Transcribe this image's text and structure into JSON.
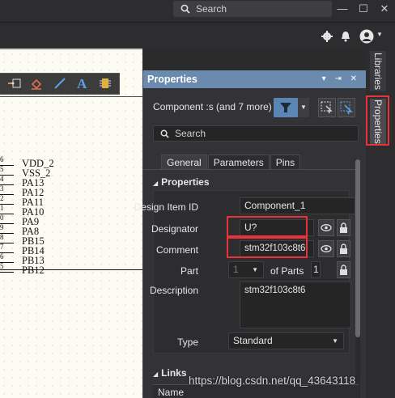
{
  "titlebar": {
    "search_placeholder": "Search",
    "minimize": "—",
    "maximize": "☐",
    "close": "✕"
  },
  "schematic": {
    "pins": [
      {
        "num": "6",
        "name": "VDD_2"
      },
      {
        "num": "5",
        "name": "VSS_2"
      },
      {
        "num": "4",
        "name": "PA13"
      },
      {
        "num": "3",
        "name": "PA12"
      },
      {
        "num": "2",
        "name": "PA11"
      },
      {
        "num": "1",
        "name": "PA10"
      },
      {
        "num": "0",
        "name": "PA9"
      },
      {
        "num": "9",
        "name": "PA8"
      },
      {
        "num": "8",
        "name": "PB15"
      },
      {
        "num": "7",
        "name": "PB14"
      },
      {
        "num": "6",
        "name": "PB13"
      },
      {
        "num": "5",
        "name": "PB12"
      }
    ]
  },
  "panel": {
    "title": "Properties",
    "header_controls": "▾ ⇥ ✕",
    "component_label": "Component  :s (and 7 more)",
    "search_placeholder": "Search",
    "tabs": [
      "General",
      "Parameters",
      "Pins"
    ],
    "section_properties": "Properties",
    "fields": {
      "design_item_id_label": "Design Item ID",
      "design_item_id_value": "Component_1",
      "designator_label": "Designator",
      "designator_value": "U?",
      "comment_label": "Comment",
      "comment_value": "stm32f103c8t6",
      "part_label": "Part",
      "part_value": "1",
      "of_parts_label": "of Parts",
      "of_parts_value": "1",
      "description_label": "Description",
      "description_value": "stm32f103c8t6",
      "type_label": "Type",
      "type_value": "Standard"
    },
    "section_links": "Links",
    "links_column": "Name"
  },
  "side_tabs": {
    "libraries": "Libraries",
    "properties": "Properties"
  },
  "watermark": "https://blog.csdn.net/qq_43643118",
  "colors": {
    "header": "#6b8bae",
    "accent": "#5a86b5",
    "highlight": "#e8333a"
  }
}
